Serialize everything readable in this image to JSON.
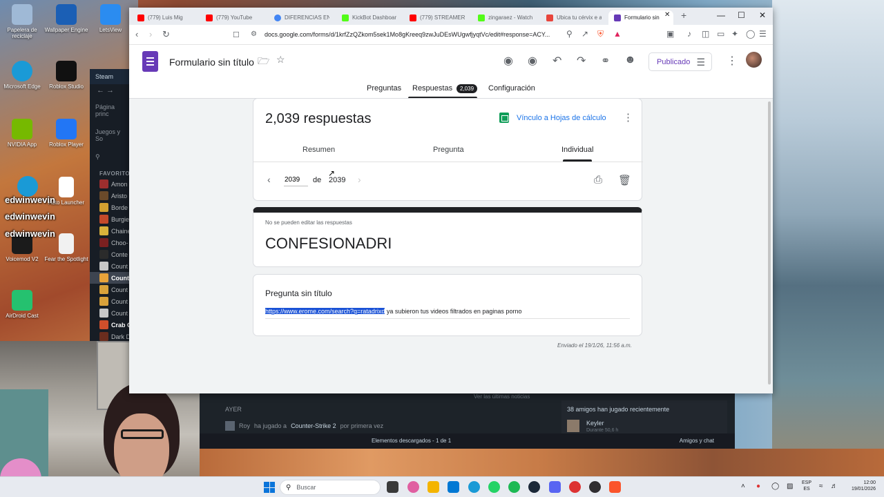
{
  "desktop": {
    "icons": [
      {
        "label": "Papelera de reciclaje",
        "color": "#9fb9d6"
      },
      {
        "label": "Wallpaper Engine",
        "color": "#1b5fb5"
      },
      {
        "label": "LetsView",
        "color": "#2b8cf0"
      },
      {
        "label": "Microsoft Edge",
        "color": "#1a9ad6"
      },
      {
        "label": "Roblox Studio",
        "color": "#111111"
      },
      {
        "label": "NVIDIA App",
        "color": "#76b900"
      },
      {
        "label": "Roblox Player",
        "color": "#2276f5"
      },
      {
        "label": "Auto Launcher",
        "color": "#ffffff"
      },
      {
        "label": "Voicemod V2",
        "color": "#1b1b1b"
      },
      {
        "label": "Fear the Spotlight",
        "color": "#f1f1f1"
      },
      {
        "label": "AirDroid Cast",
        "color": "#25c16f"
      }
    ],
    "overlay_text": [
      "edwinwevin",
      "edwinwevin",
      "edwinwevin"
    ]
  },
  "steam": {
    "title": "Steam",
    "library_label": "Página princ",
    "filter_label": "Juegos y So",
    "favorites_label": "FAVORITO",
    "games": [
      "Amon",
      "Aristo",
      "Borde",
      "Burgie",
      "Chaine",
      "Choo-",
      "Conte",
      "Count",
      "Count",
      "Count",
      "Count",
      "Count",
      "Crab G",
      "Dark D"
    ],
    "section_label": "AYER",
    "activity_user": "Roy",
    "activity_text": "ha jugado a",
    "activity_game": "Counter-Strike 2",
    "activity_suffix": "por primera vez",
    "news_link": "Ver las últimas noticias",
    "friends_played": "38 amigos han jugado recientemente",
    "friend_name": "Keyler",
    "friend_sub": "Durante 50,6 h",
    "downloads": "Elementos descargados - 1 de 1",
    "friends_chat": "Amigos y chat"
  },
  "browser": {
    "tabs": [
      {
        "title": "(779) Luis Mig",
        "color": "#ff0000"
      },
      {
        "title": "(779) YouTube",
        "color": "#ff0000"
      },
      {
        "title": "DIFERENCIAS ENT",
        "color": "#4285f4"
      },
      {
        "title": "KickBot Dashboar",
        "color": "#53fc18"
      },
      {
        "title": "(779) STREAMERS",
        "color": "#ff0000"
      },
      {
        "title": "zingaraez - Watch",
        "color": "#53fc18"
      },
      {
        "title": "Ubica tu cérvix e a",
        "color": "#e8453c"
      },
      {
        "title": "Formulario sin",
        "color": "#673ab7"
      }
    ],
    "url": "docs.google.com/forms/d/1krfZzQZkom5sek1Mo8gKreeq9zwJuDEsWUgwfjyqtVc/edit#response=ACY..."
  },
  "forms": {
    "title": "Formulario sin título",
    "publish_label": "Publicado",
    "tabs": {
      "questions": "Preguntas",
      "responses": "Respuestas",
      "responses_count": "2,039",
      "settings": "Configuración"
    },
    "summary": {
      "count_label": "2,039 respuestas",
      "sheets_link": "Vínculo a Hojas de cálculo",
      "subtabs": [
        "Resumen",
        "Pregunta",
        "Individual"
      ],
      "pager_current": "2039",
      "pager_of": "de",
      "pager_total": "2039"
    },
    "header_card": {
      "notice": "No se pueden editar las respuestas",
      "form_name": "CONFESIONADRI"
    },
    "question_card": {
      "title": "Pregunta sin título",
      "answer_link": "https://www.erome.com/search?q=ratadrixd",
      "answer_rest": " ya subieron tus videos filtrados en paginas porno"
    },
    "submitted": "Enviado el 19/1/26, 11:56 a.m."
  },
  "taskbar": {
    "search_placeholder": "Buscar",
    "apps": [
      {
        "name": "file-explorer",
        "color": "#3a3a3a"
      },
      {
        "name": "copilot",
        "color": "#e05fa1"
      },
      {
        "name": "folder",
        "color": "#f4b400"
      },
      {
        "name": "store",
        "color": "#0078d4"
      },
      {
        "name": "edge",
        "color": "#1a9ad6"
      },
      {
        "name": "whatsapp",
        "color": "#25d366"
      },
      {
        "name": "spotify",
        "color": "#1db954"
      },
      {
        "name": "steam",
        "color": "#1b2838"
      },
      {
        "name": "discord",
        "color": "#5865f2"
      },
      {
        "name": "roblox",
        "color": "#d33"
      },
      {
        "name": "obs",
        "color": "#302e31"
      },
      {
        "name": "brave",
        "color": "#fb542b"
      }
    ],
    "lang_top": "ESP",
    "lang_bottom": "ES",
    "time": "12:00",
    "date": "19/01/2026"
  }
}
